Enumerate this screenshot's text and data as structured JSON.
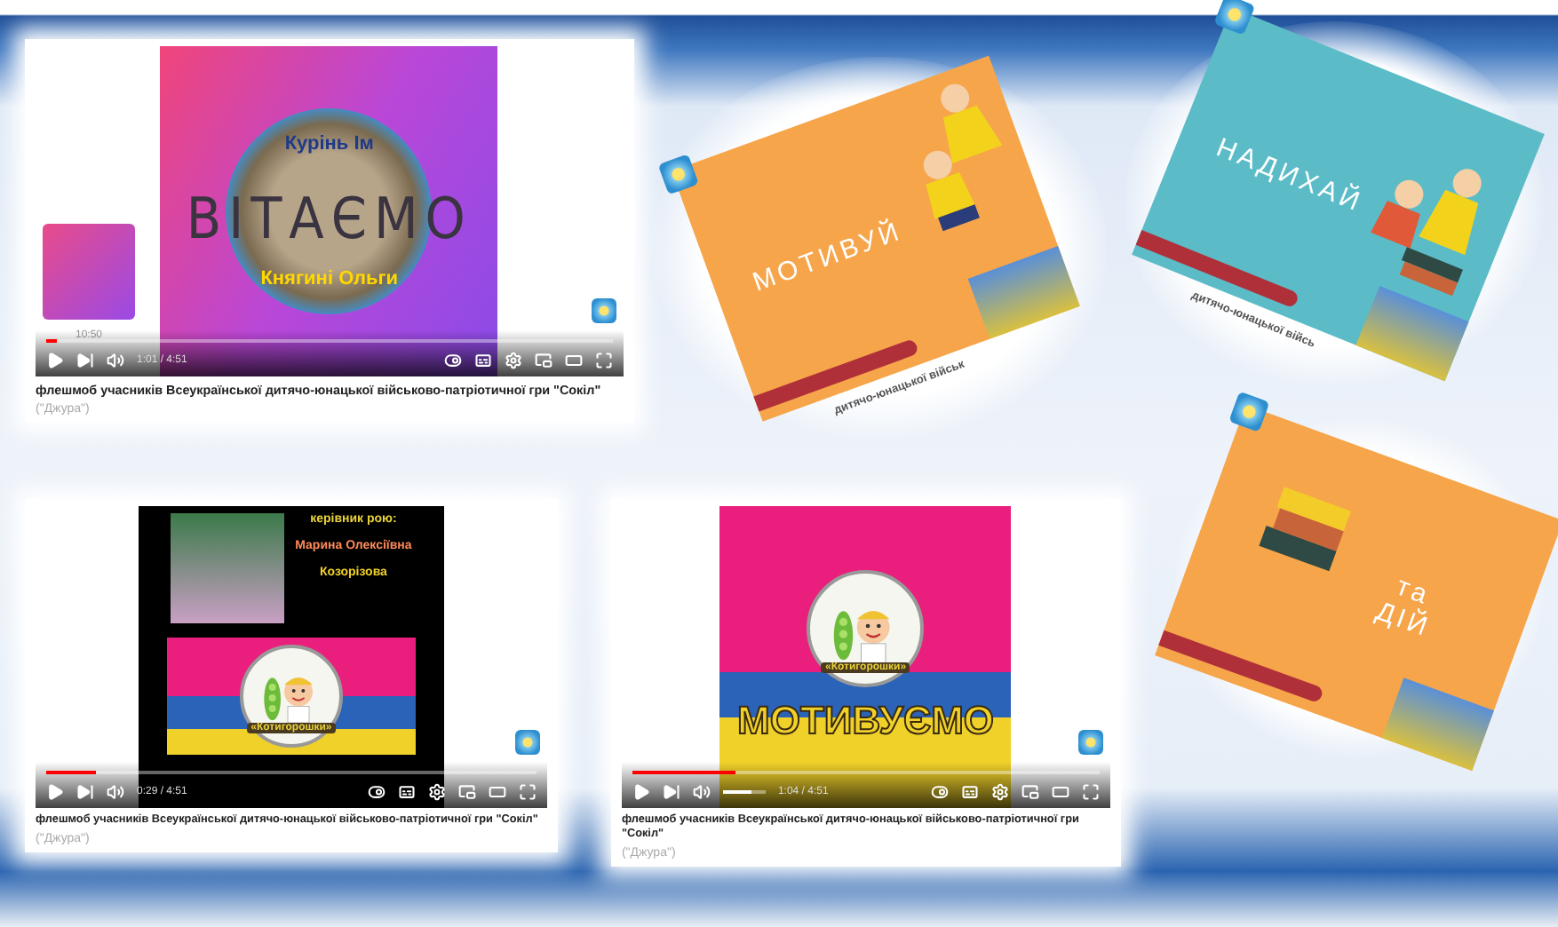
{
  "players": [
    {
      "kind": "greeting",
      "frame": {
        "top_text": "Курінь Ім",
        "headline": "ВІТАЄМО",
        "bottom_text": "Княгині Ольги",
        "side_duration": "10:50"
      },
      "progress": {
        "level": 0.02
      },
      "time": "1:01 / 4:51",
      "caption": "флешмоб учасників Всеукраїнської дитячо-юнацької військово-патріотичної гри \"Сокіл\"",
      "caption_sub": "(\"Джура\")"
    },
    {
      "kind": "leader",
      "frame": {
        "lines": [
          "керівник рою:",
          "Марина Олексіївна",
          "Козорізова"
        ],
        "badge": "«Котигорошки»"
      },
      "progress": {
        "level": 0.1
      },
      "time": "0:29 / 4:51",
      "caption": "флешмоб учасників Всеукраїнської дитячо-юнацької військово-патріотичної гри \"Сокіл\"",
      "caption_sub": "(\"Джура\")"
    },
    {
      "kind": "motivate",
      "frame": {
        "badge": "«Котигорошки»",
        "headline": "МОТИВУЄМО"
      },
      "progress": {
        "level": 0.22
      },
      "volume": {
        "level": 0.65
      },
      "time": "1:04 / 4:51",
      "caption": "флешмоб учасників Всеукраїнської дитячо-юнацької військово-патріотичної гри \"Сокіл\"",
      "caption_sub": "(\"Джура\")"
    }
  ],
  "cards": [
    {
      "kind": "children",
      "words": [
        "МОТИВУЙ"
      ],
      "caption": "дитячо-юнацької військ"
    },
    {
      "kind": "children-books",
      "words": [
        "НАДИХАЙ"
      ],
      "caption": "дитячо-юнацької війсь"
    },
    {
      "kind": "books",
      "words": [
        "та",
        "ДІЙ"
      ]
    }
  ]
}
